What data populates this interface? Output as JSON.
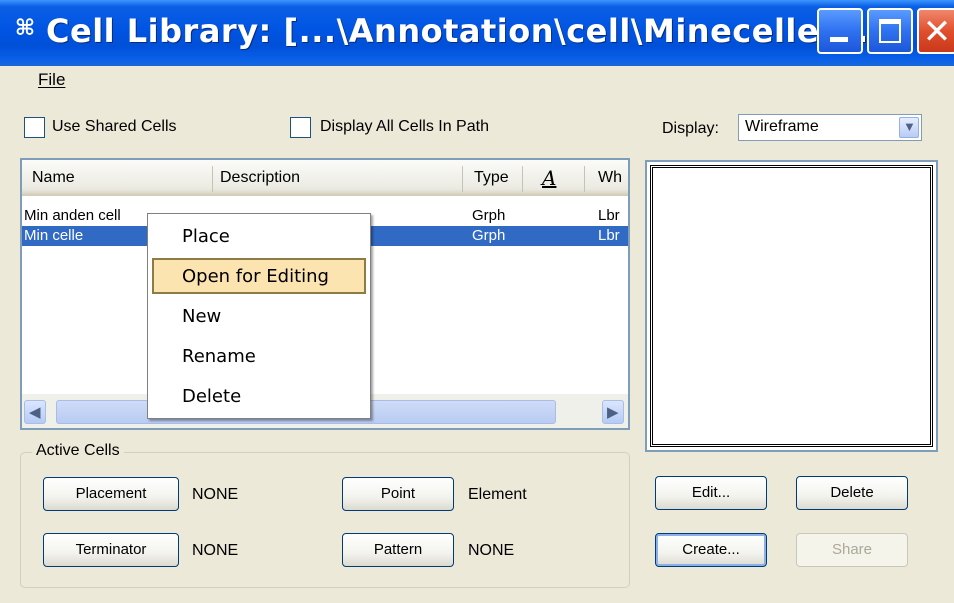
{
  "window": {
    "title": "Cell Library: [...\\Annotation\\cell\\Mineceller...",
    "app_icon": "microstation-icon"
  },
  "menu": {
    "file_label": "File"
  },
  "options": {
    "use_shared_cells_label": "Use Shared Cells",
    "use_shared_cells_checked": false,
    "display_all_label": "Display All Cells In Path",
    "display_all_checked": false
  },
  "display": {
    "label": "Display:",
    "value": "Wireframe"
  },
  "list": {
    "columns": [
      "Name",
      "Description",
      "Type",
      "Wh"
    ],
    "rows": [
      {
        "name": "Min anden cell",
        "type": "Grph",
        "where": "Lbr",
        "selected": false
      },
      {
        "name": "Min celle",
        "type": "Grph",
        "where": "Lbr",
        "selected": true
      }
    ]
  },
  "context_menu": {
    "items": [
      {
        "label": "Place",
        "highlighted": false
      },
      {
        "label": "Open for Editing",
        "highlighted": true
      },
      {
        "label": "New",
        "highlighted": false
      },
      {
        "label": "Rename",
        "highlighted": false
      },
      {
        "label": "Delete",
        "highlighted": false
      }
    ]
  },
  "active_cells": {
    "title": "Active Cells",
    "placement": {
      "button": "Placement",
      "value": "NONE"
    },
    "point": {
      "button": "Point",
      "value": "Element"
    },
    "terminator": {
      "button": "Terminator",
      "value": "NONE"
    },
    "pattern": {
      "button": "Pattern",
      "value": "NONE"
    }
  },
  "actions": {
    "edit": "Edit...",
    "delete": "Delete",
    "create": "Create...",
    "share": "Share",
    "share_enabled": false
  },
  "colors": {
    "titlebar": "#0054e3",
    "selection": "#316ac5",
    "menu_highlight": "#fbe4b0",
    "window_bg": "#ece9d8"
  }
}
